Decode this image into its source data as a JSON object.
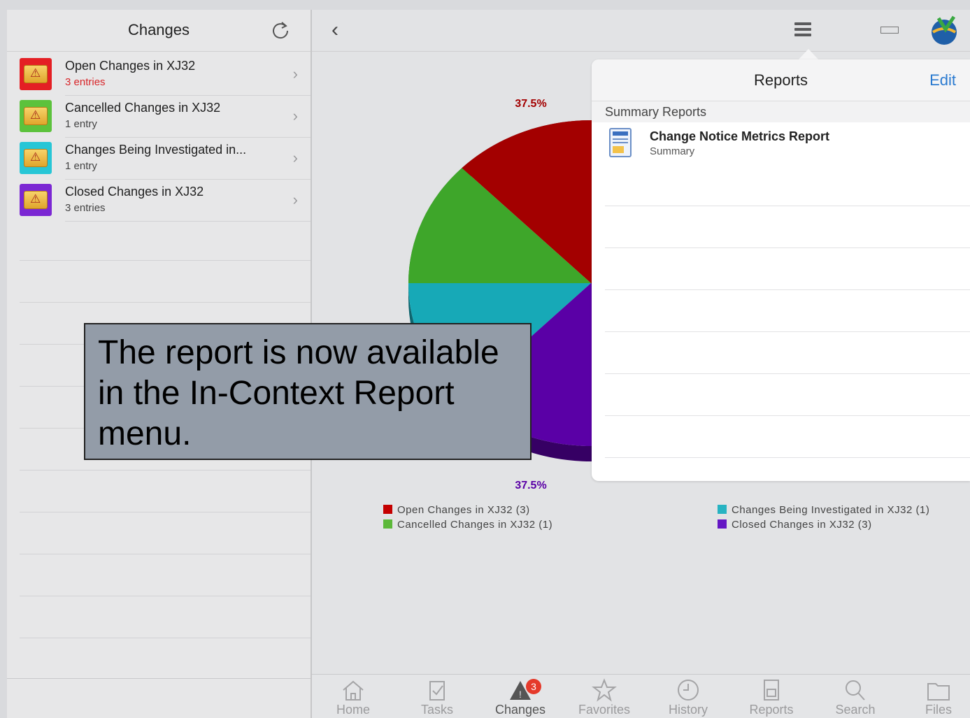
{
  "left_pane": {
    "title": "Changes",
    "items": [
      {
        "title": "Open Changes in XJ32",
        "subtitle": "3 entries",
        "color": "#e41f24",
        "subtitle_red": true
      },
      {
        "title": "Cancelled Changes in XJ32",
        "subtitle": "1 entry",
        "color": "#5cc23c",
        "subtitle_red": false
      },
      {
        "title": "Changes Being Investigated in...",
        "subtitle": "1 entry",
        "color": "#27c6d6",
        "subtitle_red": false
      },
      {
        "title": "Closed Changes in XJ32",
        "subtitle": "3 entries",
        "color": "#7b27d3",
        "subtitle_red": false
      }
    ]
  },
  "toolbar": {
    "back_icon": "chevron-left-icon",
    "menu_icon": "hamburger-icon",
    "ruler_icon": "ruler-icon",
    "logo_icon": "globe-logo-icon"
  },
  "chart_data": {
    "type": "pie",
    "categories": [
      "Open Changes in XJ32 (3)",
      "Cancelled Changes in XJ32 (1)",
      "Changes Being Investigated in XJ32 (1)",
      "Closed Changes in XJ32 (3)"
    ],
    "values": [
      3,
      1,
      1,
      3
    ],
    "colors": [
      "#a30000",
      "#3ea62a",
      "#17a9b7",
      "#5a00a6"
    ],
    "data_labels": [
      "37.5%",
      "37.5%"
    ],
    "legend_position": "bottom"
  },
  "popover": {
    "title": "Reports",
    "edit_label": "Edit",
    "section": "Summary Reports",
    "report_title": "Change Notice Metrics Report",
    "report_subtitle": "Summary"
  },
  "caption": {
    "text": "The report is now available in the In-Context Report menu."
  },
  "tabbar": {
    "tabs": [
      {
        "label": "Home",
        "icon": "home-icon"
      },
      {
        "label": "Tasks",
        "icon": "tasks-icon"
      },
      {
        "label": "Changes",
        "icon": "changes-icon",
        "badge": "3"
      },
      {
        "label": "Favorites",
        "icon": "star-icon"
      },
      {
        "label": "History",
        "icon": "clock-icon"
      },
      {
        "label": "Reports",
        "icon": "reports-icon"
      },
      {
        "label": "Search",
        "icon": "search-icon"
      },
      {
        "label": "Files",
        "icon": "folder-icon"
      }
    ]
  }
}
